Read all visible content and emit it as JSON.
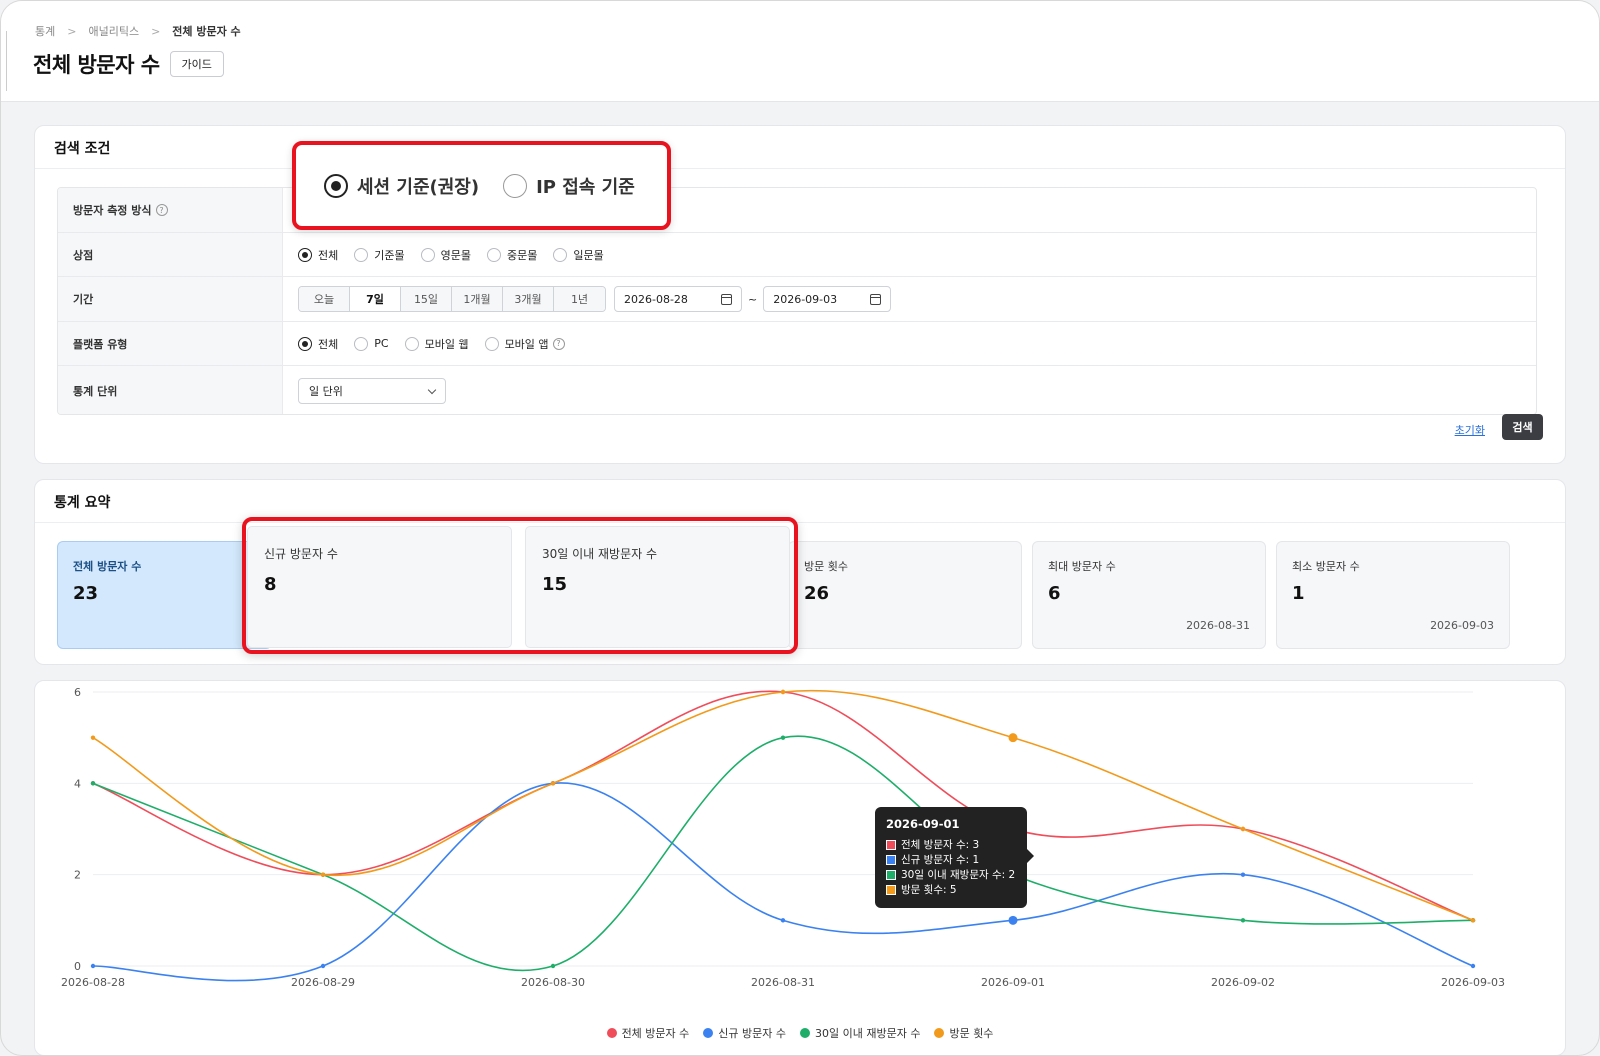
{
  "breadcrumb": [
    "통계",
    "애널리틱스",
    "전체 방문자 수"
  ],
  "breadcrumb_sep": ">",
  "page_title": "전체 방문자 수",
  "guide_label": "가이드",
  "search": {
    "title": "검색 조건",
    "measure": {
      "label": "방문자 측정 방식",
      "help": "?",
      "options": [
        "세션 기준(권장)",
        "IP 접속 기준"
      ],
      "selected": 0
    },
    "store": {
      "label": "상점",
      "options": [
        "전체",
        "기준몰",
        "영문몰",
        "중문몰",
        "일문몰"
      ],
      "selected": 0
    },
    "period": {
      "label": "기간",
      "presets": [
        "오늘",
        "7일",
        "15일",
        "1개월",
        "3개월",
        "1년"
      ],
      "selected": 1,
      "start": "2026-08-28",
      "end": "2026-09-03",
      "tilde": "~"
    },
    "platform": {
      "label": "플랫폼 유형",
      "options": [
        "전체",
        "PC",
        "모바일 웹",
        "모바일 앱"
      ],
      "selected": 0,
      "help": "?"
    },
    "unit": {
      "label": "통계 단위",
      "value": "일 단위"
    },
    "reset_label": "초기화",
    "search_label": "검색"
  },
  "summary": {
    "title": "통계 요약",
    "stats": [
      {
        "label": "전체 방문자 수",
        "value": "23",
        "sub": ""
      },
      {
        "label": "신규 방문자 수",
        "value": "8",
        "sub": ""
      },
      {
        "label": "30일 이내 재방문자 수",
        "value": "15",
        "sub": ""
      },
      {
        "label": "방문 횟수",
        "value": "26",
        "sub": ""
      },
      {
        "label": "최대 방문자 수",
        "value": "6",
        "sub": "2026-08-31"
      },
      {
        "label": "최소 방문자 수",
        "value": "1",
        "sub": "2026-09-03"
      }
    ]
  },
  "chart_data": {
    "type": "line",
    "x": [
      "2026-08-28",
      "2026-08-29",
      "2026-08-30",
      "2026-08-31",
      "2026-09-01",
      "2026-09-02",
      "2026-09-03"
    ],
    "ylim": [
      0,
      6
    ],
    "yticks": [
      0,
      2,
      4,
      6
    ],
    "grid": true,
    "legend": "bottom-center",
    "series": [
      {
        "name": "전체 방문자 수",
        "color": "#ef4d5a",
        "values": [
          4,
          2,
          4,
          6,
          3,
          3,
          1
        ]
      },
      {
        "name": "신규 방문자 수",
        "color": "#3b82f0",
        "values": [
          0,
          0,
          4,
          1,
          1,
          2,
          0
        ]
      },
      {
        "name": "30일 이내 재방문자 수",
        "color": "#1fae6a",
        "values": [
          4,
          2,
          0,
          5,
          2,
          1,
          1
        ]
      },
      {
        "name": "방문 횟수",
        "color": "#f29a1c",
        "values": [
          5,
          2,
          4,
          6,
          5,
          3,
          1
        ]
      }
    ],
    "tooltip": {
      "title": "2026-09-01",
      "rows": [
        "전체 방문자 수: 3",
        "신규 방문자 수: 1",
        "30일 이내 재방문자 수: 2",
        "방문 횟수: 5"
      ]
    }
  }
}
